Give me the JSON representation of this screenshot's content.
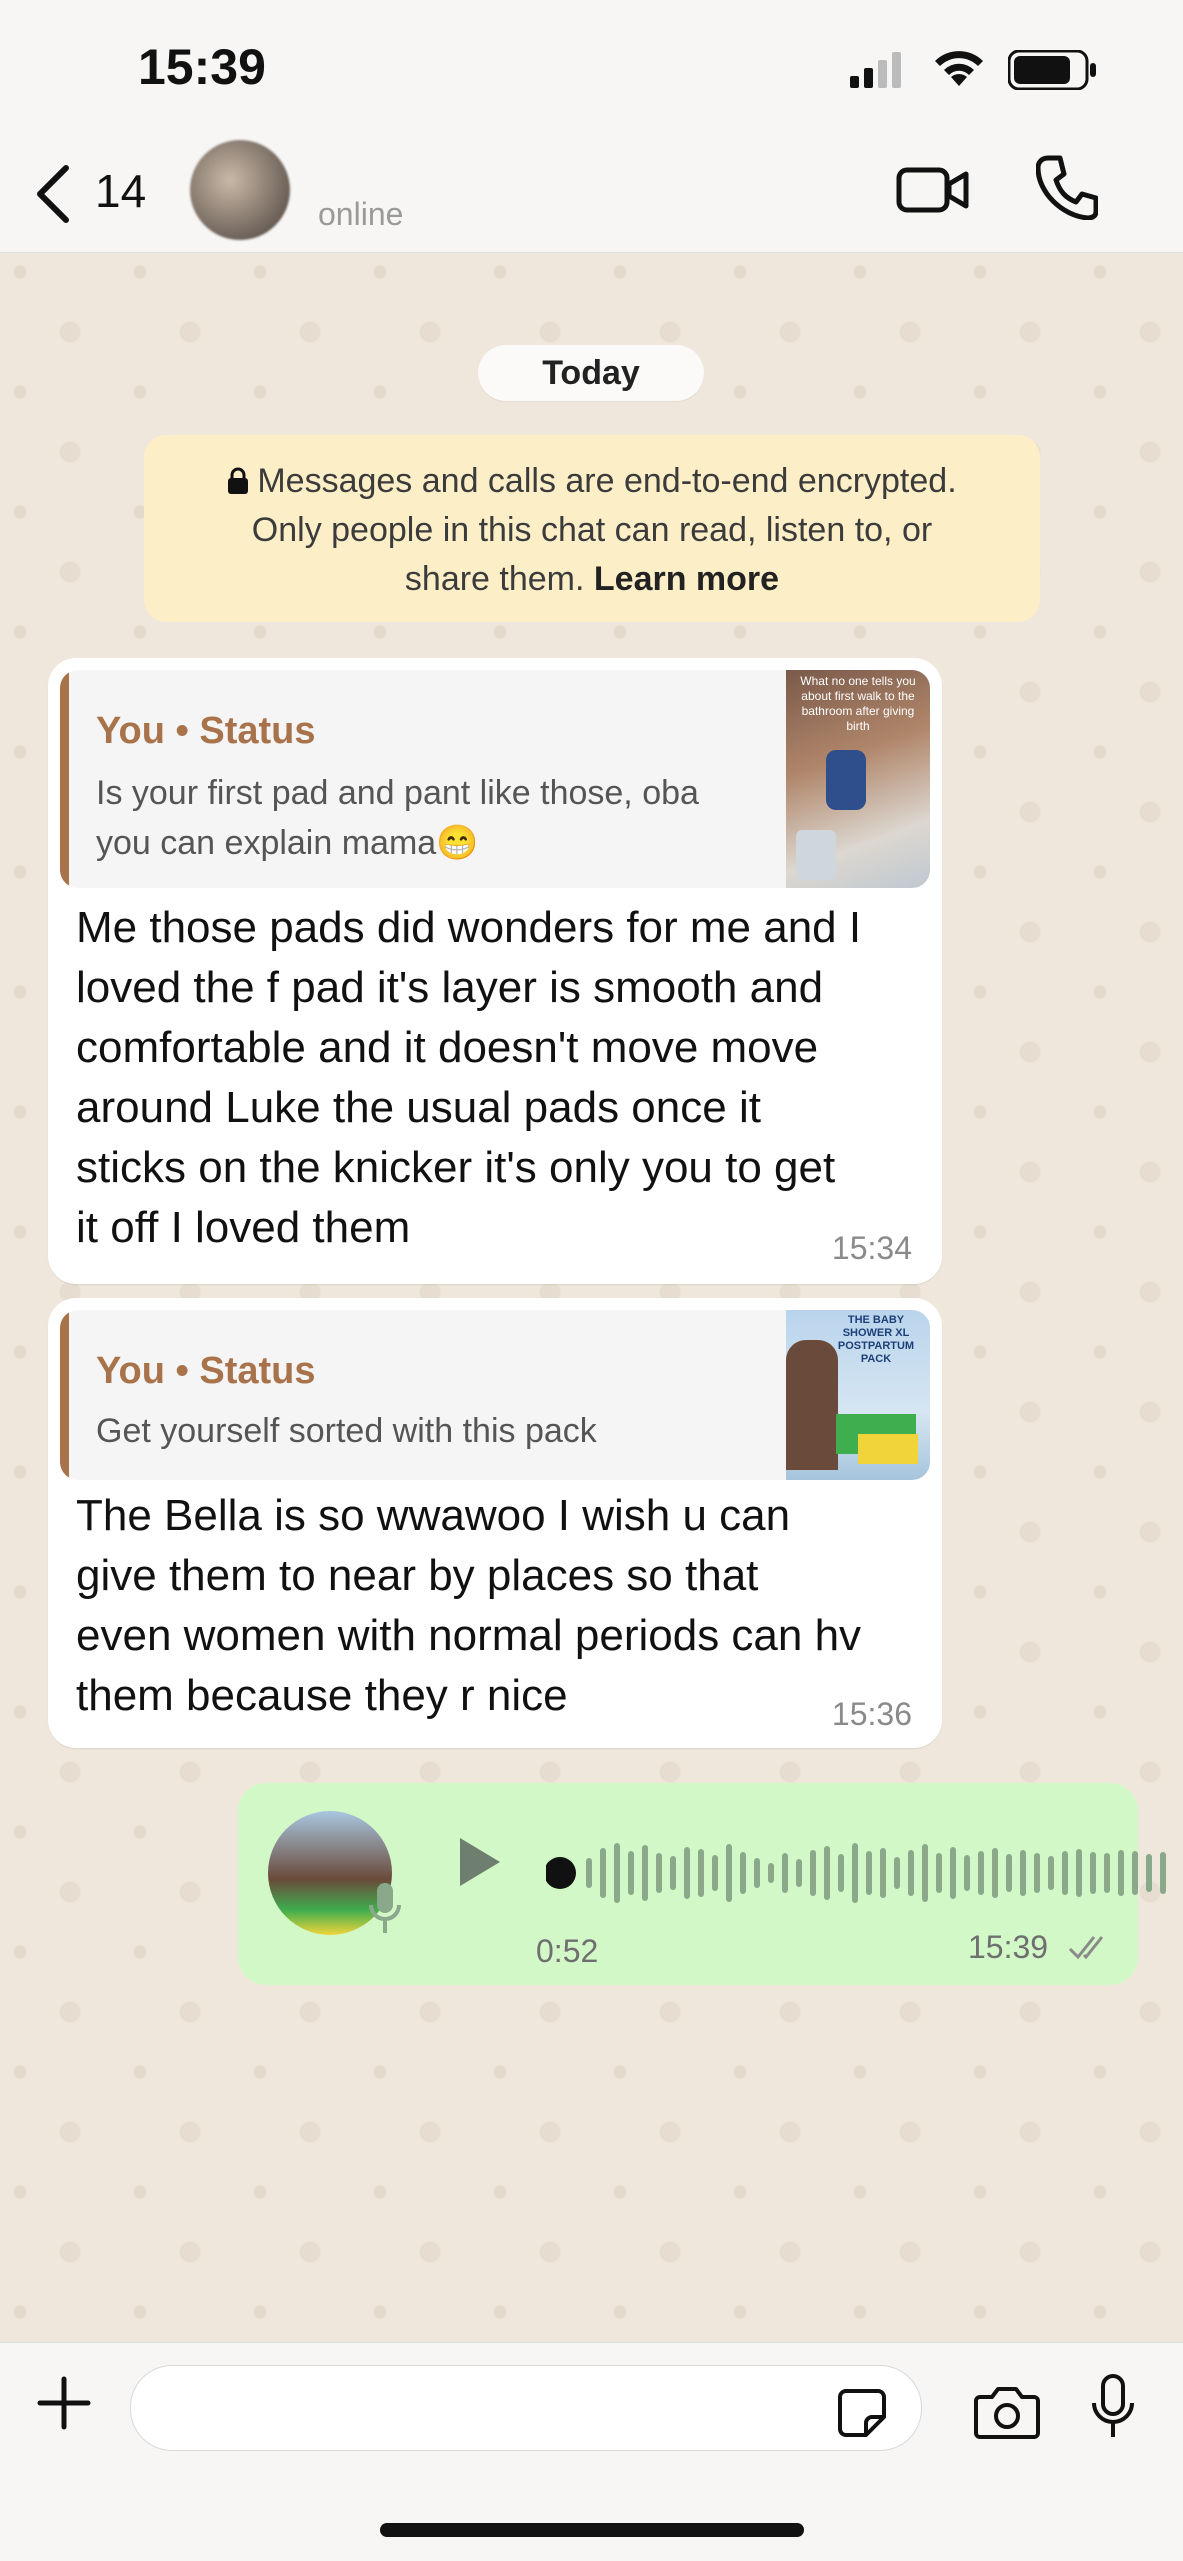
{
  "status_bar": {
    "time": "15:39"
  },
  "header": {
    "back_count": "14",
    "presence": "online"
  },
  "date_chip": "Today",
  "encryption_notice": {
    "line1": "Messages and calls are end-to-end encrypted.",
    "line2": "Only people in this chat can read, listen to, or",
    "line3_prefix": "share them. ",
    "learn_more": "Learn more"
  },
  "messages": [
    {
      "quote_author": "You • Status",
      "quote_line1": "Is your first pad and pant like those, oba",
      "quote_line2": "you can explain mama😁",
      "thumb_caption": "What no one tells you about first walk to the bathroom after giving birth",
      "text_lines": [
        "Me those pads did wonders for me and I",
        "loved the f pad it's layer is smooth and",
        "comfortable and it doesn't move move",
        "around Luke the usual pads once it",
        "sticks on the knicker it's only you to get",
        "it off I loved them"
      ],
      "time": "15:34"
    },
    {
      "quote_author": "You • Status",
      "quote_line1": "Get yourself sorted with this pack",
      "thumb_caption": "THE BABY SHOWER XL POSTPARTUM PACK",
      "text_lines": [
        "The Bella is so wwawoo I wish u can",
        "give them to near by places so that",
        "even women with normal periods can hv",
        "them because they r nice"
      ],
      "time": "15:36"
    }
  ],
  "voice_note": {
    "duration": "0:52",
    "time": "15:39",
    "progress": 0
  },
  "colors": {
    "accent_brown": "#a8734a",
    "outgoing_bubble": "#d3f8c8",
    "notice_bg": "#fcefc8"
  }
}
